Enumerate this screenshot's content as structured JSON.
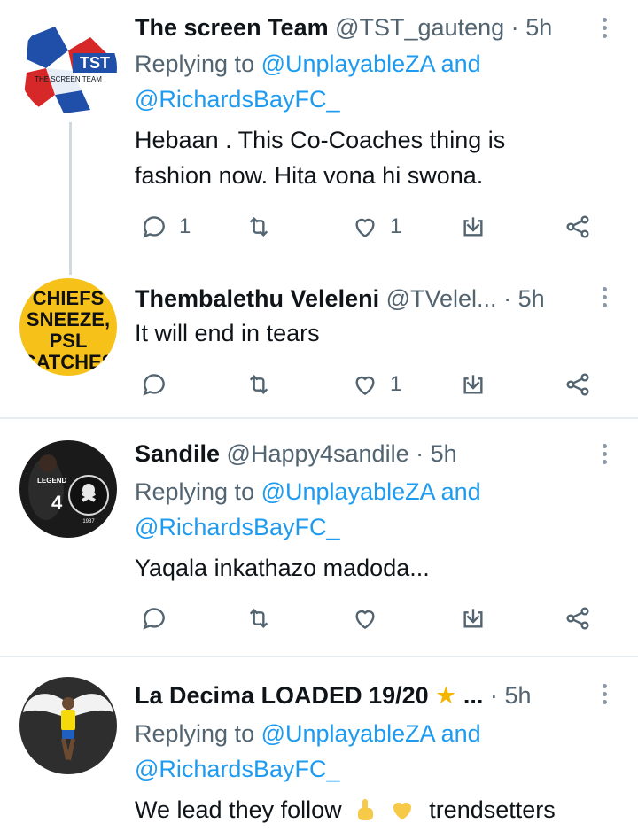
{
  "tweets": [
    {
      "name": "The screen Team",
      "handle": "@TST_gauteng",
      "time": "5h",
      "replying_prefix": "Replying to",
      "replying_to_1": "@UnplayableZA",
      "replying_and": "and",
      "replying_to_2": "@RichardsBayFC_",
      "text_lines": [
        "Hebaan . This Co-Coaches thing is",
        "fashion now. Hita vona hi swona."
      ],
      "reply_count": "1",
      "like_count": "1",
      "avatar_text": "TST",
      "avatar_subtext": "THE SCREEN TEAM"
    },
    {
      "name": "Thembalethu Veleleni",
      "handle": "@TVelel...",
      "time": "5h",
      "text": "It will end in tears",
      "like_count": "1",
      "avatar_lines": [
        "CHIEFS",
        "SNEEZE,",
        "PSL",
        "CATCHES"
      ]
    },
    {
      "name": "Sandile",
      "handle": "@Happy4sandile",
      "time": "5h",
      "replying_prefix": "Replying to",
      "replying_to_1": "@UnplayableZA",
      "replying_and": "and",
      "replying_to_2": "@RichardsBayFC_",
      "text": "Yaqala inkathazo madoda...",
      "avatar_text": "LEGEND",
      "avatar_number": "4",
      "avatar_year": "1937"
    },
    {
      "name": "La Decima LOADED 19/20",
      "name_suffix": "...",
      "time": "5h",
      "replying_prefix": "Replying to",
      "replying_to_1": "@UnplayableZA",
      "replying_and": "and",
      "replying_to_2": "@RichardsBayFC_",
      "text_start": "We lead they follow",
      "text_end": "trendsetters"
    }
  ],
  "colors": {
    "link": "#1d9bf0",
    "secondary": "#536471",
    "divider": "#e6ecf0",
    "star": "#f4b400",
    "heart": "#f7c948"
  },
  "icons": [
    "reply-icon",
    "retweet-icon",
    "like-icon",
    "share-icon",
    "more-options-icon"
  ]
}
